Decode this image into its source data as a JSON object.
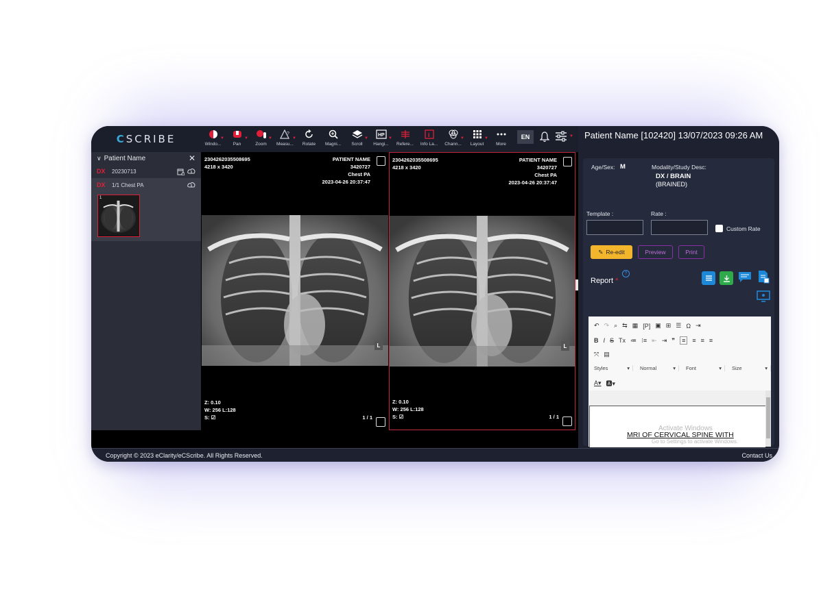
{
  "app": {
    "logo": "SCRIBE",
    "logo_prefix": "C"
  },
  "toolbar": {
    "tools": [
      {
        "label": "Windo...",
        "icon": "window-level-icon",
        "dropdown": true
      },
      {
        "label": "Pan",
        "icon": "pan-icon",
        "dropdown": true
      },
      {
        "label": "Zoom",
        "icon": "zoom-icon",
        "dropdown": true
      },
      {
        "label": "Measu...",
        "icon": "measure-icon",
        "dropdown": true
      },
      {
        "label": "Rotate",
        "icon": "rotate-icon",
        "dropdown": false
      },
      {
        "label": "Magni...",
        "icon": "magnify-icon",
        "dropdown": false
      },
      {
        "label": "Scroll",
        "icon": "scroll-layers-icon",
        "dropdown": true
      },
      {
        "label": "Hangi...",
        "icon": "hanging-protocol-icon",
        "dropdown": true
      },
      {
        "label": "Refere...",
        "icon": "reference-line-icon",
        "dropdown": false
      },
      {
        "label": "Info La...",
        "icon": "info-layer-icon",
        "dropdown": false
      },
      {
        "label": "Chann...",
        "icon": "channel-icon",
        "dropdown": true
      },
      {
        "label": "Layout",
        "icon": "layout-grid-icon",
        "dropdown": true
      },
      {
        "label": "More",
        "icon": "more-icon",
        "dropdown": false
      }
    ],
    "lang": "EN"
  },
  "sidebar": {
    "title": "Patient Name",
    "study": {
      "modality": "DX",
      "date": "20230713"
    },
    "series": {
      "modality": "DX",
      "label": "1/1 Chest PA"
    },
    "thumb_index": "1"
  },
  "viewports": [
    {
      "id": "2304262035508695",
      "size": "4218 x 3420",
      "patient": "PATIENT NAME",
      "patient_id": "3420727",
      "desc": "Chest PA",
      "datetime": "2023-04-26 20:37:47",
      "zoom": "Z: 0.10",
      "wl": "W: 256 L:128",
      "sync": "S:",
      "frame": "1 / 1",
      "marker": "L"
    },
    {
      "id": "2304262035508695",
      "size": "4218 x 3420",
      "patient": "PATIENT NAME",
      "patient_id": "3420727",
      "desc": "Chest PA",
      "datetime": "2023-04-26 20:37:47",
      "zoom": "Z: 0.10",
      "wl": "W: 256 L:128",
      "sync": "S:",
      "frame": "1 / 1",
      "marker": "L"
    }
  ],
  "panel": {
    "title": "Patient Name   [102420] 13/07/2023 09:26 AM",
    "age_sex_label": "Age/Sex:",
    "age_sex_value": "M",
    "modality_label": "Modality/Study Desc:",
    "modality_value": "DX / BRAIN",
    "modality_value2": "(BRAINED)",
    "template_label": "Template :",
    "rate_label": "Rate :",
    "custom_rate_label": "Custom Rate",
    "reedit_label": "Re-edit",
    "preview_label": "Preview",
    "print_label": "Print",
    "report_label": "Report",
    "required_mark": "*",
    "help_mark": "?"
  },
  "editor": {
    "styles": "Styles",
    "format": "Normal",
    "font": "Font",
    "size": "Size",
    "heading": "MRI OF CERVICAL SPINE WITH",
    "watermark1": "Activate Windows",
    "watermark2": "Go to Settings to activate Windows."
  },
  "footer": {
    "copyright": "Copyright © 2023 eClarity/eCScribe. All Rights Reserved.",
    "contact": "Contact Us"
  },
  "colors": {
    "accent_red": "#e0203a",
    "panel_bg": "#1e2130",
    "card_bg": "#252a3d",
    "reedit_yellow": "#f3b52b",
    "purple": "#8b2fa6",
    "blue": "#1e88d8",
    "green": "#2eaa4a"
  }
}
